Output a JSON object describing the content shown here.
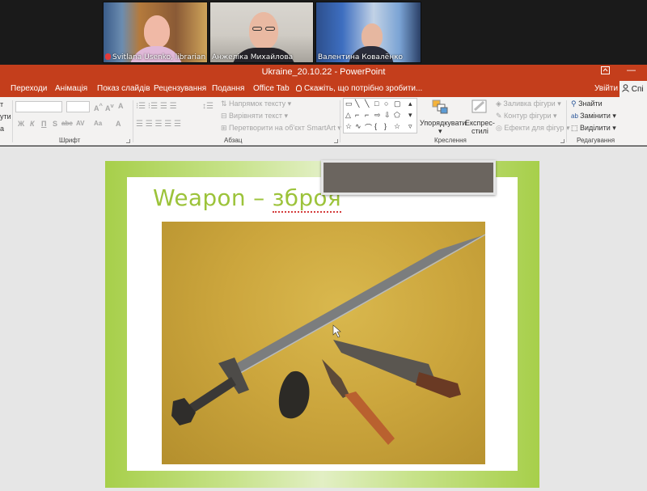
{
  "video_call": {
    "participants": [
      {
        "name": "Svitlana Usenko, librarian ...",
        "muted": true
      },
      {
        "name": "Анжеліка Михайлова",
        "muted": false
      },
      {
        "name": "Валентина Ковалёнко",
        "muted": false
      }
    ]
  },
  "window": {
    "title": "Ukraine_20.10.22 - PowerPoint",
    "ribbon_display_icon": "ribbon-display-options-icon",
    "minimize": "—"
  },
  "tabs": [
    {
      "label": "Переходи"
    },
    {
      "label": "Анімація"
    },
    {
      "label": "Показ слайдів"
    },
    {
      "label": "Рецензування"
    },
    {
      "label": "Подання"
    },
    {
      "label": "Office Tab"
    }
  ],
  "tell_me": "Скажіть, що потрібно зробити...",
  "sign_in": "Увійти",
  "share": "Спі",
  "ribbon": {
    "groups": {
      "font": "Шрифт",
      "paragraph": "Абзац",
      "drawing": "Креслення",
      "editing": "Редагування"
    },
    "clipboard_partial": [
      "т",
      "ути",
      "а"
    ],
    "font_format_buttons": [
      "Ж",
      "К",
      "П",
      "S",
      "abc",
      "AV",
      "Aa",
      "A"
    ],
    "text_direction": "Напрямок тексту",
    "align_text": "Вирівняти текст",
    "smartart": "Перетворити на об'єкт SmartArt",
    "arrange": "Упорядкувати",
    "quick_styles": "Експрес-\nстилі",
    "shape_fill": "Заливка фігури",
    "shape_outline": "Контур фігури",
    "shape_effects": "Ефекти для фігур",
    "find": "Знайти",
    "replace": "Замінити",
    "select": "Виділити"
  },
  "slide": {
    "title_plain": "Weapon – ",
    "title_underlined": "зброя",
    "image": "photo of a sword, a dagger in a scabbard, a spearhead and a stone artifact on a yellow table"
  },
  "colors": {
    "accent": "#c43e1c",
    "title_green": "#9cc33a",
    "slide_border_green": "#a7cf4a"
  }
}
